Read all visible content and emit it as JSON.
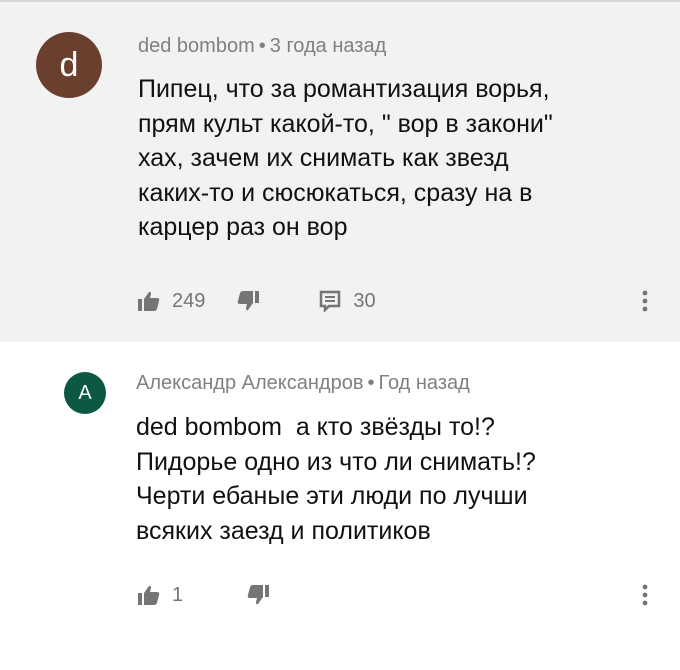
{
  "comments": [
    {
      "avatar_letter": "d",
      "avatar_color": "#6b3f2e",
      "author": "ded bombom",
      "separator": "•",
      "time": "3 года назад",
      "text_lines": [
        "Пипец, что за романтизация ворья,",
        "прям культ какой-то, \" вор в закони\"",
        "хах, зачем их снимать как звезд",
        "каких-то и сюсюкаться, сразу на в",
        "карцер раз он вор"
      ],
      "likes": "249",
      "replies": "30",
      "icons": {
        "like": "thumb-up-icon",
        "dislike": "thumb-down-icon",
        "replies": "comment-icon",
        "menu": "more-vert-icon"
      }
    },
    {
      "avatar_letter": "A",
      "avatar_color": "#0b5843",
      "author": "Александр Александров",
      "separator": "•",
      "time": "Год назад",
      "text_lines": [
        "ded bombom  а кто звёзды то!?",
        "Пидорье одно из что ли снимать!?",
        "Черти ебаные эти люди по лучши",
        "всяких заезд и политиков"
      ],
      "likes": "1",
      "icons": {
        "like": "thumb-up-icon",
        "dislike": "thumb-down-icon",
        "menu": "more-vert-icon"
      }
    }
  ],
  "colors": {
    "highlight_background": "#f2f2f2",
    "meta_text": "#808080",
    "body_text": "#111111",
    "icon": "#757575"
  }
}
